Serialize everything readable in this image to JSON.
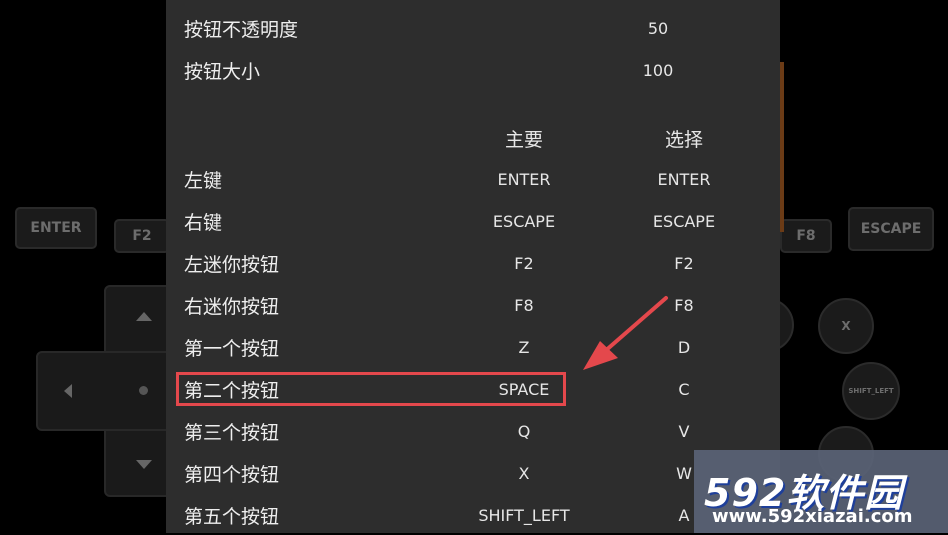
{
  "background_controls": {
    "enter_label": "ENTER",
    "f2_label": "F2",
    "f8_label": "F8",
    "escape_label": "ESCAPE",
    "x_label": "X",
    "shift_left_label": "SHIFT_LEFT"
  },
  "settings": {
    "opacity": {
      "label": "按钮不透明度",
      "value": "50"
    },
    "size": {
      "label": "按钮大小",
      "value": "100"
    },
    "columns": {
      "primary": "主要",
      "alternate": "选择"
    },
    "mappings": [
      {
        "label": "左键",
        "primary": "ENTER",
        "alternate": "ENTER"
      },
      {
        "label": "右键",
        "primary": "ESCAPE",
        "alternate": "ESCAPE"
      },
      {
        "label": "左迷你按钮",
        "primary": "F2",
        "alternate": "F2"
      },
      {
        "label": "右迷你按钮",
        "primary": "F8",
        "alternate": "F8"
      },
      {
        "label": "第一个按钮",
        "primary": "Z",
        "alternate": "D"
      },
      {
        "label": "第二个按钮",
        "primary": "SPACE",
        "alternate": "C"
      },
      {
        "label": "第三个按钮",
        "primary": "Q",
        "alternate": "V"
      },
      {
        "label": "第四个按钮",
        "primary": "X",
        "alternate": "W"
      },
      {
        "label": "第五个按钮",
        "primary": "SHIFT_LEFT",
        "alternate": "A"
      }
    ]
  },
  "watermark": {
    "logo": "592软件园",
    "url": "www.592xiazai.com"
  },
  "colors": {
    "panel": "#2d2d2d",
    "highlight": "#e4484c",
    "watermark_blue": "#2f6fe0"
  }
}
